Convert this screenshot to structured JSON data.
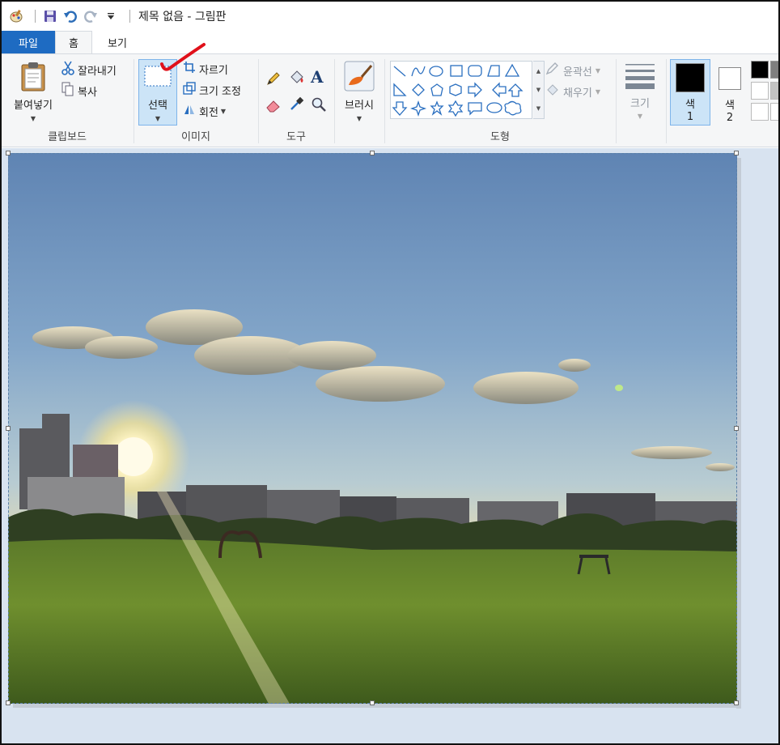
{
  "window": {
    "title": "제목 없음 - 그림판"
  },
  "quick_access": {
    "icons": [
      "paint-app-icon",
      "save-icon",
      "undo-icon",
      "redo-icon",
      "customize-dropdown-icon"
    ]
  },
  "tabs": {
    "file": "파일",
    "home": "홈",
    "view": "보기"
  },
  "clipboard": {
    "paste": "붙여넣기",
    "cut": "잘라내기",
    "copy": "복사",
    "group": "클립보드"
  },
  "image": {
    "select": "선택",
    "crop": "자르기",
    "resize": "크기 조정",
    "rotate": "회전",
    "group": "이미지"
  },
  "tools": {
    "group": "도구"
  },
  "brushes": {
    "label": "브러시"
  },
  "shapes": {
    "outline": "윤곽선",
    "fill": "채우기",
    "group": "도형"
  },
  "size": {
    "label": "크기"
  },
  "colors": {
    "color1_line1": "색",
    "color1_line2": "1",
    "color2_line1": "색",
    "color2_line2": "2",
    "color1_value": "#000000",
    "color2_value": "#ffffff",
    "palette": [
      "#000000",
      "#7f7f7f",
      "#ffffff",
      "#c3c3c3",
      "#ffffff",
      "#ffffff"
    ]
  },
  "accents": {
    "file_tab": "#1e6bc2",
    "select_highlight": "#cce4f7",
    "annotation_mark": "#e0101a"
  }
}
